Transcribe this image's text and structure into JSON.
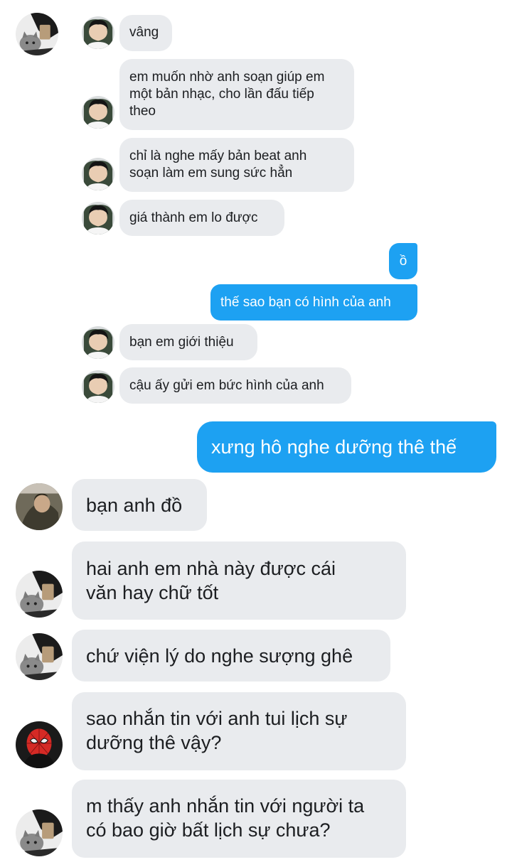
{
  "thread": {
    "messages": [
      {
        "id": "m1",
        "sender": "boy",
        "text": "vâng"
      },
      {
        "id": "m2",
        "sender": "boy",
        "text": "em muốn nhờ anh soạn giúp em\nmột bản nhạc, cho lần đấu tiếp\ntheo"
      },
      {
        "id": "m3",
        "sender": "boy",
        "text": "chỉ là nghe mấy bản beat anh\nsoạn làm em sung sức hẳn"
      },
      {
        "id": "m4",
        "sender": "boy",
        "text": "giá thành em lo được"
      },
      {
        "id": "m5",
        "sender": "me",
        "text": "ồ"
      },
      {
        "id": "m6",
        "sender": "me",
        "text": "thế sao bạn có hình của anh"
      },
      {
        "id": "m7",
        "sender": "boy",
        "text": "bạn em giới thiệu"
      },
      {
        "id": "m8",
        "sender": "boy",
        "text": "cậu ấy gửi em bức hình của anh"
      },
      {
        "id": "m9",
        "sender": "me",
        "text": "xưng hô nghe dưỡng thê thế"
      },
      {
        "id": "m10",
        "sender": "friend",
        "text": "bạn anh đồ"
      },
      {
        "id": "m11",
        "sender": "cat",
        "text": "hai anh em nhà này được cái\nvăn hay chữ tốt"
      },
      {
        "id": "m12",
        "sender": "cat",
        "text": "chứ viện lý do nghe sượng ghê"
      },
      {
        "id": "m13",
        "sender": "spider",
        "text": "sao nhắn tin với anh tui lịch sự\ndưỡng thê vậy?"
      },
      {
        "id": "m14",
        "sender": "cat",
        "text": "m thấy anh nhắn tin với người ta\ncó bao giờ bất lịch sự chưa?"
      }
    ]
  },
  "avatars": {
    "cat": "cat-avatar-icon",
    "boy": "boy-avatar-icon",
    "friend": "friend-avatar-icon",
    "spider": "spider-mask-avatar-icon"
  },
  "colors": {
    "incoming_bubble": "#e9ebee",
    "outgoing_bubble": "#1da1f2",
    "incoming_text": "#1c1e21",
    "outgoing_text": "#ffffff"
  }
}
